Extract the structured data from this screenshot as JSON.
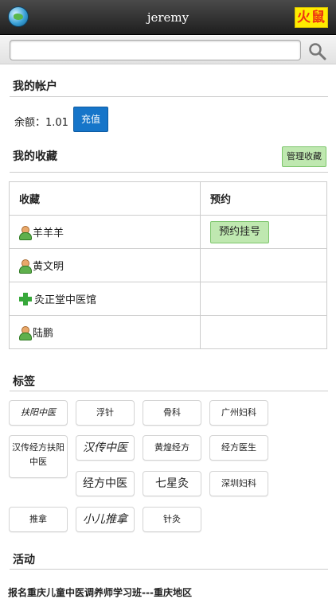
{
  "header": {
    "title": "jeremy",
    "logo_text": "火鼠"
  },
  "search": {
    "placeholder": "",
    "value": ""
  },
  "account": {
    "section_title": "我的帐户",
    "balance_label": "余额：1.01",
    "recharge_label": "充值"
  },
  "favorites": {
    "section_title": "我的收藏",
    "manage_label": "管理收藏",
    "table": {
      "headers": [
        "收藏",
        "预约"
      ],
      "rows": [
        {
          "icon": "person-icon",
          "name": "羊羊羊",
          "action": "预约挂号"
        },
        {
          "icon": "person-icon",
          "name": "黄文明",
          "action": ""
        },
        {
          "icon": "green-cross-icon",
          "name": "灸正堂中医馆",
          "action": ""
        },
        {
          "icon": "person-icon",
          "name": "陆鹏",
          "action": ""
        }
      ]
    }
  },
  "tags": {
    "section_title": "标签",
    "items": [
      "扶阳中医",
      "浮针",
      "骨科",
      "广州妇科",
      "汉传经方扶阳中医",
      "汉传中医",
      "黄煌经方",
      "经方医生",
      "经方中医",
      "七星灸",
      "深圳妇科",
      "推拿",
      "小儿推拿",
      "针灸"
    ]
  },
  "activity": {
    "section_title": "活动",
    "first_item": "报名重庆儿童中医调养师学习班---重庆地区"
  }
}
